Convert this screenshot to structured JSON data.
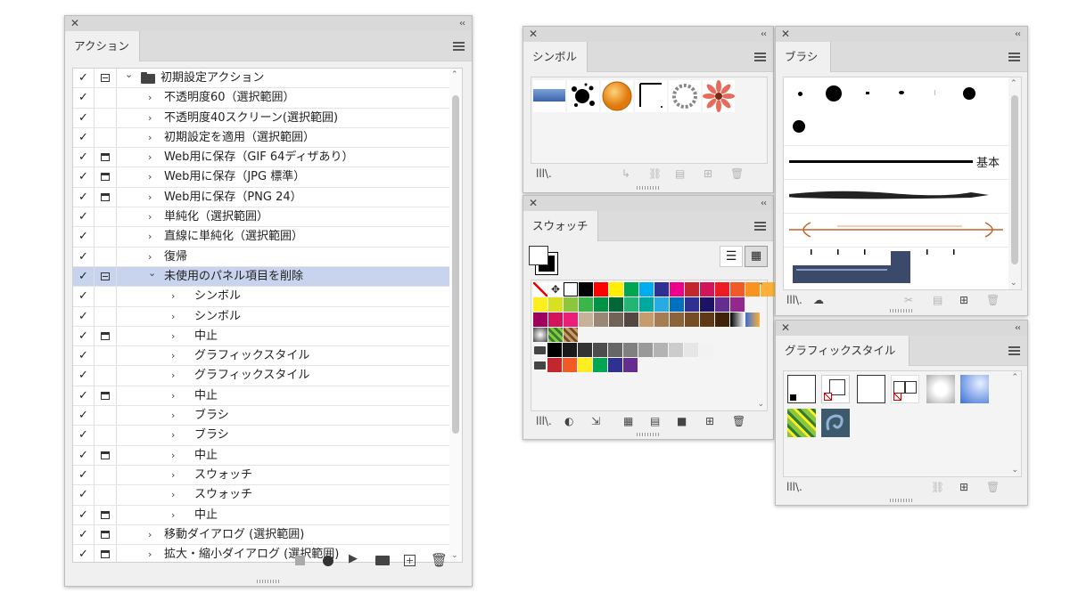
{
  "actions": {
    "tab": "アクション",
    "rows": [
      {
        "label": "初期設定アクション",
        "level": 0,
        "dlg": "toggle",
        "open": true,
        "folder": true
      },
      {
        "label": "不透明度60（選択範囲）",
        "level": 1,
        "dlg": "none"
      },
      {
        "label": "不透明度40スクリーン(選択範囲)",
        "level": 1,
        "dlg": "none"
      },
      {
        "label": "初期設定を適用（選択範囲）",
        "level": 1,
        "dlg": "none"
      },
      {
        "label": "Web用に保存（GIF 64ディザあり）",
        "level": 1,
        "dlg": "box"
      },
      {
        "label": "Web用に保存（JPG 標準）",
        "level": 1,
        "dlg": "box"
      },
      {
        "label": "Web用に保存（PNG 24）",
        "level": 1,
        "dlg": "box"
      },
      {
        "label": "単純化（選択範囲）",
        "level": 1,
        "dlg": "none"
      },
      {
        "label": "直線に単純化（選択範囲）",
        "level": 1,
        "dlg": "none"
      },
      {
        "label": "復帰",
        "level": 1,
        "dlg": "none"
      },
      {
        "label": "未使用のパネル項目を削除",
        "level": 1,
        "dlg": "toggle",
        "open": true,
        "selected": true
      },
      {
        "label": "シンボル",
        "level": 2,
        "dlg": "none"
      },
      {
        "label": "シンボル",
        "level": 2,
        "dlg": "none"
      },
      {
        "label": "中止",
        "level": 2,
        "dlg": "box"
      },
      {
        "label": "グラフィックスタイル",
        "level": 2,
        "dlg": "none"
      },
      {
        "label": "グラフィックスタイル",
        "level": 2,
        "dlg": "none"
      },
      {
        "label": "中止",
        "level": 2,
        "dlg": "box"
      },
      {
        "label": "ブラシ",
        "level": 2,
        "dlg": "none"
      },
      {
        "label": "ブラシ",
        "level": 2,
        "dlg": "none"
      },
      {
        "label": "中止",
        "level": 2,
        "dlg": "box"
      },
      {
        "label": "スウォッチ",
        "level": 2,
        "dlg": "none"
      },
      {
        "label": "スウォッチ",
        "level": 2,
        "dlg": "none"
      },
      {
        "label": "中止",
        "level": 2,
        "dlg": "box"
      },
      {
        "label": "移動ダイアログ (選択範囲)",
        "level": 1,
        "dlg": "box"
      },
      {
        "label": "拡大・縮小ダイアログ (選択範囲)",
        "level": 1,
        "dlg": "box"
      }
    ],
    "check": "✓",
    "toolbar_icons": [
      "stop-icon",
      "record-icon",
      "play-icon",
      "new-set-icon",
      "new-action-icon",
      "delete-icon"
    ]
  },
  "symbols": {
    "tab": "シンボル"
  },
  "swatches": {
    "tab": "スウォッチ",
    "rows": [
      [
        "#ffffff",
        "#000000",
        "#ff0000",
        "#ffee00",
        "#00a651",
        "#00aeef",
        "#2e3192",
        "#ec008c",
        "#c1272d",
        "#d4145a",
        "#ed1c24",
        "#f15a24",
        "#f7931e",
        "#fbb03b"
      ],
      [
        "#fcee21",
        "#d9e021",
        "#8cc63f",
        "#39b54a",
        "#009245",
        "#006837",
        "#22b573",
        "#00a99d",
        "#29abe2",
        "#0071bc",
        "#2e3192",
        "#1b1464",
        "#662d91",
        "#93278f"
      ],
      [
        "#9e005d",
        "#d4145a",
        "#ed1e79",
        "#c7b299",
        "#998675",
        "#736357",
        "#534741",
        "#c69c6d",
        "#a67c52",
        "#8c6239",
        "#754c24",
        "#603813",
        "#42210b",
        "#808080"
      ],
      [
        "#000000",
        "#1a1a1a",
        "#333333",
        "#4d4d4d",
        "#666666",
        "#808080",
        "#999999",
        "#b3b3b3",
        "#cccccc",
        "#e6e6e6",
        "#f2f2f2"
      ],
      [
        "#c1272d",
        "#f15a24",
        "#fcee21",
        "#00a651",
        "#2e3192",
        "#662d91"
      ]
    ]
  },
  "brushes": {
    "tab": "ブラシ",
    "basic_label": "基本"
  },
  "graphic_styles": {
    "tab": "グラフィックスタイル"
  }
}
